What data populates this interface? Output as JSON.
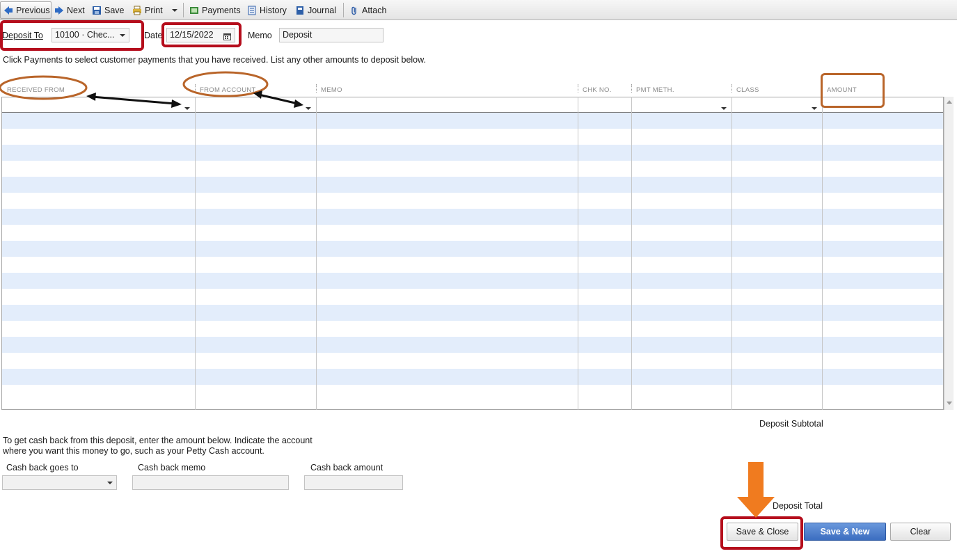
{
  "toolbar": {
    "previous": "Previous",
    "next": "Next",
    "save": "Save",
    "print": "Print",
    "payments": "Payments",
    "history": "History",
    "journal": "Journal",
    "attach": "Attach"
  },
  "header": {
    "deposit_to_label": "Deposit To",
    "deposit_to_value": "10100 · Chec...",
    "date_label": "Date",
    "date_value": "12/15/2022",
    "memo_label": "Memo",
    "memo_value": "Deposit",
    "instructions": "Click Payments to select customer payments that you have received. List any other amounts to deposit below."
  },
  "table": {
    "columns": [
      "RECEIVED FROM",
      "FROM ACCOUNT",
      "MEMO",
      "CHK NO.",
      "PMT METH.",
      "CLASS",
      "AMOUNT"
    ],
    "row_count": 19
  },
  "totals": {
    "subtotal_label": "Deposit Subtotal",
    "total_label": "Deposit Total"
  },
  "cash_back": {
    "instructions_line1": "To get cash back from this deposit, enter the amount below.  Indicate the account",
    "instructions_line2": "where you want this money to go, such as your Petty Cash account.",
    "goes_to_label": "Cash back goes to",
    "memo_label": "Cash back memo",
    "amount_label": "Cash back amount"
  },
  "buttons": {
    "save_close": "Save & Close",
    "save_new": "Save & New",
    "clear": "Clear"
  },
  "colors": {
    "row_stripe": "#e3edfb",
    "highlight_red": "#b50d1c",
    "highlight_brown": "#b9652a",
    "arrow_orange": "#f07b1f",
    "primary_button": "#3b6dc0"
  },
  "icons": [
    "arrow-left-icon",
    "arrow-right-icon",
    "save-icon",
    "printer-icon",
    "payments-icon",
    "history-icon",
    "journal-icon",
    "paperclip-icon",
    "calendar-icon",
    "chevron-down-icon"
  ]
}
